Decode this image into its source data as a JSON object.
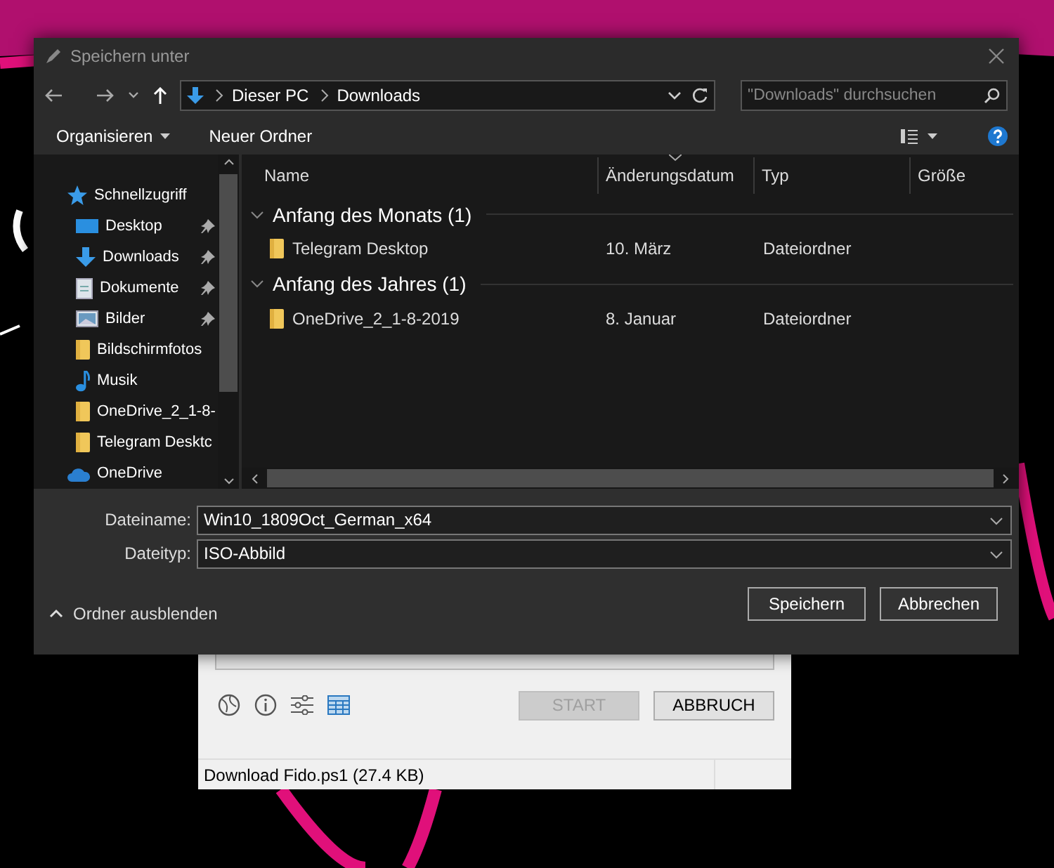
{
  "dialog": {
    "title": "Speichern unter",
    "breadcrumb": [
      "Dieser PC",
      "Downloads"
    ],
    "search": {
      "placeholder": "\"Downloads\" durchsuchen"
    },
    "toolbar": [
      "Organisieren",
      "Neuer Ordner"
    ],
    "sidebar": {
      "items": [
        {
          "label": "Schnellzugriff",
          "kind": "star",
          "pinned": false,
          "children": [
            {
              "label": "Desktop",
              "kind": "desktop",
              "pinned": true
            },
            {
              "label": "Downloads",
              "kind": "download",
              "pinned": true
            },
            {
              "label": "Dokumente",
              "kind": "document",
              "pinned": true
            },
            {
              "label": "Bilder",
              "kind": "picture",
              "pinned": true
            },
            {
              "label": "Bildschirmfotos",
              "kind": "folder",
              "pinned": false
            },
            {
              "label": "Musik",
              "kind": "music",
              "pinned": false
            },
            {
              "label": "OneDrive_2_1-8-",
              "kind": "folder",
              "pinned": false
            },
            {
              "label": "Telegram Desktc",
              "kind": "folder",
              "pinned": false
            }
          ]
        },
        {
          "label": "OneDrive",
          "kind": "cloud",
          "pinned": false
        }
      ]
    },
    "columns": [
      {
        "label": "Name",
        "sorted": false
      },
      {
        "label": "Änderungsdatum",
        "sorted": true
      },
      {
        "label": "Typ",
        "sorted": false
      },
      {
        "label": "Größe",
        "sorted": false
      }
    ],
    "groups": [
      {
        "label": "Anfang des Monats (1)",
        "expanded": true,
        "rows": [
          {
            "name": "Telegram Desktop",
            "date": "10. März",
            "type": "Dateiordner"
          }
        ]
      },
      {
        "label": "Anfang des Jahres (1)",
        "expanded": true,
        "rows": [
          {
            "name": "OneDrive_2_1-8-2019",
            "date": "8. Januar",
            "type": "Dateiordner"
          }
        ]
      }
    ],
    "fields": [
      {
        "label": "Dateiname:",
        "value": "Win10_1809Oct_German_x64"
      },
      {
        "label": "Dateityp:",
        "value": "ISO-Abbild"
      }
    ],
    "toggle": "Ordner ausblenden",
    "buttons": [
      "Speichern",
      "Abbrechen"
    ]
  },
  "fido": {
    "buttons": [
      {
        "label": "START",
        "disabled": true
      },
      {
        "label": "ABBRUCH",
        "disabled": false
      }
    ],
    "status_bar": "Download Fido.ps1 (27.4 KB)"
  }
}
